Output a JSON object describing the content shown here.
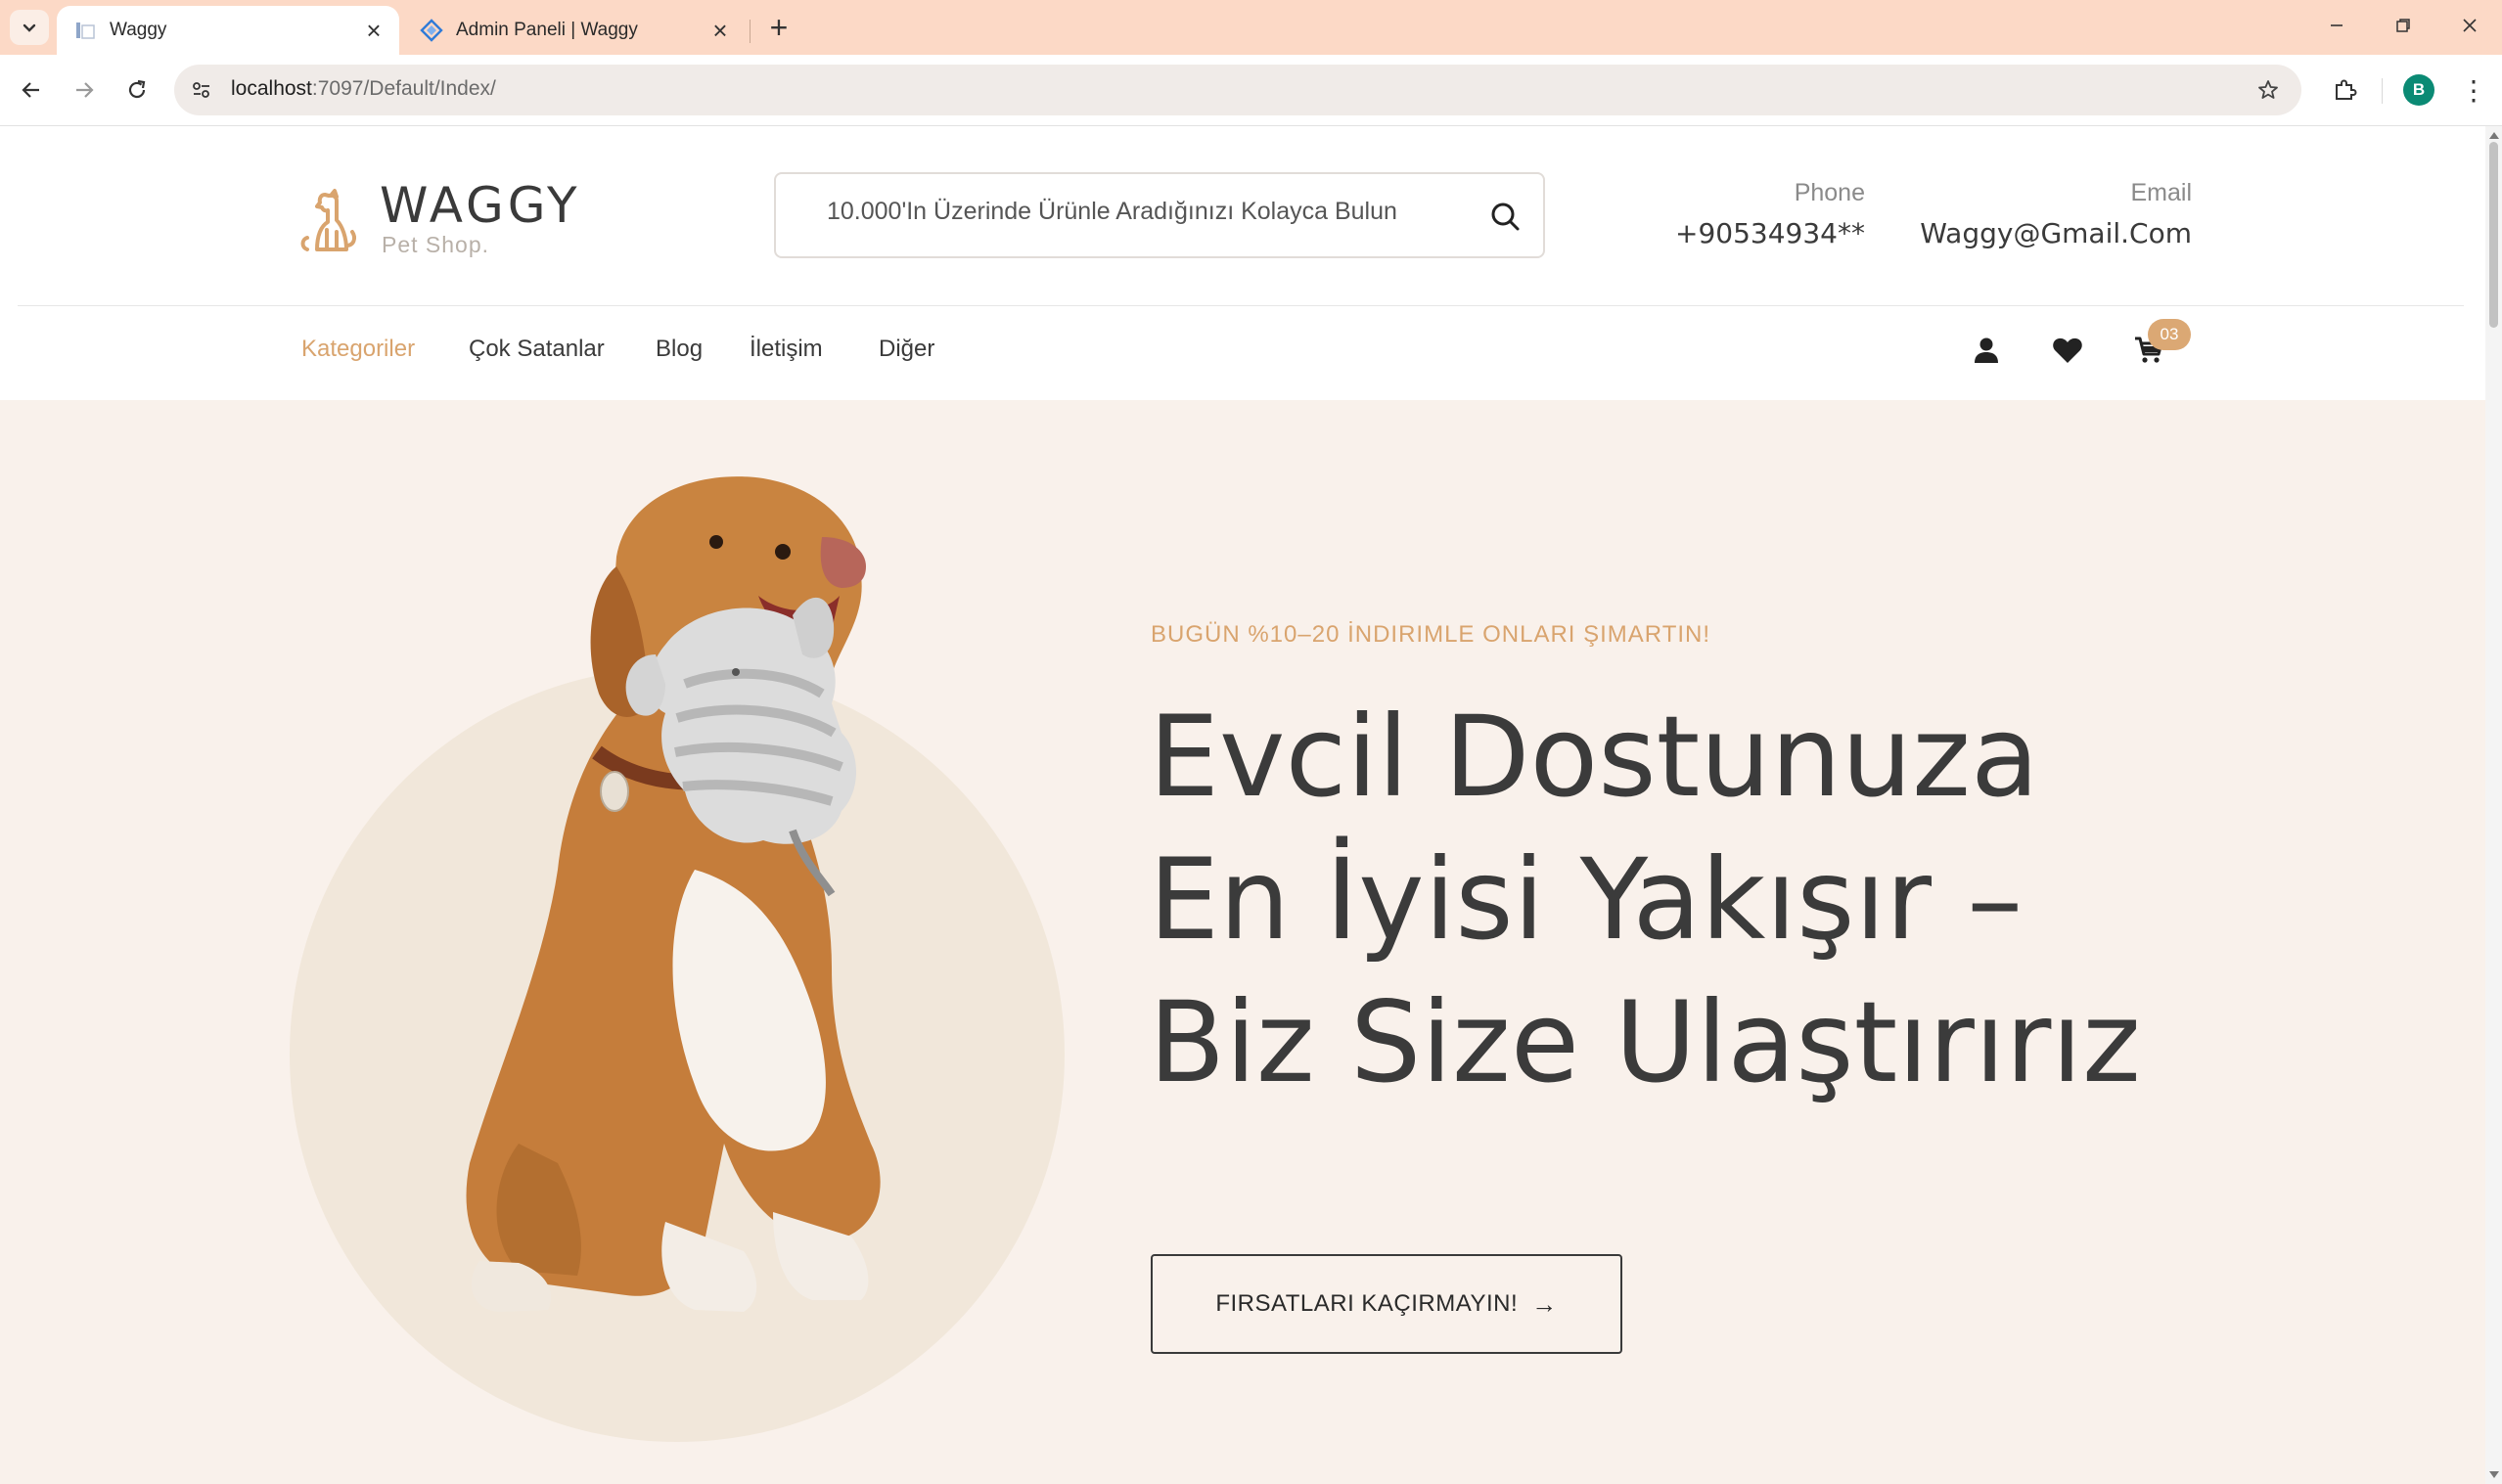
{
  "browser": {
    "tabs": [
      {
        "title": "Waggy",
        "active": true
      },
      {
        "title": "Admin Paneli | Waggy",
        "active": false
      }
    ],
    "url_host": "localhost",
    "url_rest": ":7097/Default/Index/",
    "profile_initial": "B",
    "colors": {
      "tabstrip": "#fcd9c6",
      "profile": "#0b8a74"
    }
  },
  "header": {
    "logo_word": "WAGGY",
    "logo_sub": "Pet Shop.",
    "search_placeholder": "10.000'In Üzerinde Ürünle Aradığınızı Kolayca Bulun",
    "phone_label": "Phone",
    "phone_value": "+90534934**",
    "email_label": "Email",
    "email_value": "Waggy@Gmail.Com"
  },
  "nav": {
    "items": [
      "Kategoriler",
      "Çok Satanlar",
      "Blog",
      "İletişim",
      "Diğer"
    ],
    "active_index": 0,
    "cart_count": "03",
    "accent_color": "#d9a46e"
  },
  "hero": {
    "eyebrow": "BUGÜN %10–20 İNDIRIMLE ONLARI ŞIMARTIN!",
    "headline_lines": [
      "Evcil Dostunuza",
      "En İyisi Yakışır –",
      "Biz Size Ulaştırırız"
    ],
    "cta_label": "FIRSATLARI KAÇIRMAYIN!",
    "slides": 3,
    "active_slide": 0,
    "background": "#f9f1eb"
  }
}
